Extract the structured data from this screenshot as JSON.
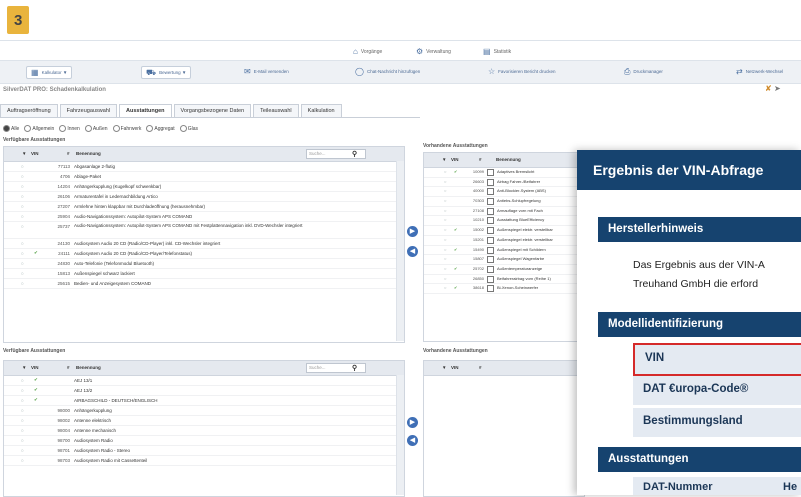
{
  "logo": {
    "text": "3"
  },
  "nav": {
    "items": [
      {
        "label": "Vorgänge",
        "icon": "home-icon"
      },
      {
        "label": "Verwaltung",
        "icon": "gear-icon"
      },
      {
        "label": "Statistik",
        "icon": "chart-icon"
      }
    ]
  },
  "toolbar": {
    "items": [
      {
        "label": "Kalkulator ▼",
        "icon": "calculator-icon"
      },
      {
        "label": "Bewertung ▼",
        "icon": "car-icon"
      },
      {
        "label": "E-Mail versenden",
        "icon": "mail-icon"
      },
      {
        "label": "Chat-Nachricht hinzufügen",
        "icon": "chat-icon"
      },
      {
        "label": "Favorisieren Bericht drucken",
        "icon": "star-icon"
      },
      {
        "label": "Druckmanager",
        "icon": "printer-icon"
      },
      {
        "label": "Netzwerk-Wechsel",
        "icon": "swap-icon"
      }
    ]
  },
  "app": {
    "title": "SilverDAT PRO: Schadenkalkulation"
  },
  "tabs": [
    "Auftragseröffnung",
    "Fahrzeugauswahl",
    "Ausstattungen",
    "Vorgangsbezogene Daten",
    "Teileauswahl",
    "Kalkulation"
  ],
  "filters": [
    "Alle",
    "Allgemein",
    "Innen",
    "Außen",
    "Fahrwerk",
    "Aggregat",
    "Glas"
  ],
  "left_top": {
    "title": "Verfügbare Ausstattungen",
    "headers": {
      "vin": "VIN",
      "hash": "#",
      "name": "Benennung"
    },
    "search_placeholder": "Suche...",
    "rows": [
      {
        "num": "77113",
        "name": "Abgasanlage 2-flutig",
        "vin": ""
      },
      {
        "num": "4706",
        "name": "Ablage-Paket",
        "vin": ""
      },
      {
        "num": "14204",
        "name": "Anhängerkupplung (Kugelkopf schwenkbar)",
        "vin": ""
      },
      {
        "num": "26106",
        "name": "Armaturentafel in Ledernachbildung Artico",
        "vin": ""
      },
      {
        "num": "27207",
        "name": "Armlehne hinten klappbar mit Durchladeöffnung (herausnehmbar)",
        "vin": ""
      },
      {
        "num": "25904",
        "name": "Audio-Navigationssystem: Autopilot-System APS COMAND",
        "vin": ""
      },
      {
        "num": "25737",
        "name": "Audio-Navigationssystem: Autopilot-System APS COMAND mit Festplattennavigation inkl. DVD-Wechsler integriert",
        "vin": ""
      },
      {
        "num": "24130",
        "name": "Audiosystem Audio 20 CD (Radio/CD-Player) inkl. CD-Wechsler integriert",
        "vin": ""
      },
      {
        "num": "24111",
        "name": "Audiosystem Audio 20 CD (Radio/CD-Player/Telefonstatus)",
        "vin": "✔"
      },
      {
        "num": "24830",
        "name": "Auto-Telefonie (Telefonmodul Bluetooth)",
        "vin": ""
      },
      {
        "num": "15813",
        "name": "Außenspiegel schwarz lackiert",
        "vin": ""
      },
      {
        "num": "25615",
        "name": "Bedien- und Anzeigesystem COMAND",
        "vin": ""
      }
    ]
  },
  "left_bottom": {
    "title": "Verfügbare Ausstattungen",
    "headers": {
      "vin": "VIN",
      "hash": "#",
      "name": "Benennung"
    },
    "search_placeholder": "Suche...",
    "rows": [
      {
        "num": "",
        "name": "AEJ 13/1",
        "vin": "✔"
      },
      {
        "num": "",
        "name": "AEJ 13/2",
        "vin": "✔"
      },
      {
        "num": "",
        "name": "AIRBAGSCHILD - DEUTSCH/ENGLISCH",
        "vin": "✔"
      },
      {
        "num": "98000",
        "name": "Anhängerkupplung",
        "vin": ""
      },
      {
        "num": "98002",
        "name": "Antenne elektrisch",
        "vin": ""
      },
      {
        "num": "98004",
        "name": "Antenne mechanisch",
        "vin": ""
      },
      {
        "num": "98700",
        "name": "Audiosystem Radio",
        "vin": ""
      },
      {
        "num": "98701",
        "name": "Audiosystem Radio - Stereo",
        "vin": ""
      },
      {
        "num": "98703",
        "name": "Audiosystem Radio mit Cassettenteil",
        "vin": ""
      }
    ]
  },
  "right_top": {
    "title": "Vorhandene Ausstattungen",
    "headers": {
      "vin": "VIN",
      "hash": "#",
      "name": "Benennung"
    },
    "rows": [
      {
        "num": "10099",
        "name": "Adaptives Bremslicht",
        "vin": "✔"
      },
      {
        "num": "26603",
        "name": "Airbag Fahrer-/Beifahrer",
        "vin": ""
      },
      {
        "num": "40000",
        "name": "Anti-Blockier-System (ABS)",
        "vin": ""
      },
      {
        "num": "70303",
        "name": "Antiebs-Schlupfregelung",
        "vin": ""
      },
      {
        "num": "27108",
        "name": "Armauflage vorn mit Fach",
        "vin": ""
      },
      {
        "num": "10210",
        "name": "Ausstattung BlueEfficiency",
        "vin": ""
      },
      {
        "num": "15002",
        "name": "Außenspiegel elektr. verstellbar",
        "vin": "✔"
      },
      {
        "num": "15201",
        "name": "Außenspiegel elektr. verstellbar",
        "vin": ""
      },
      {
        "num": "15490",
        "name": "Außenspiegel mit Schildern",
        "vin": "✔"
      },
      {
        "num": "15807",
        "name": "Außenspiegel Wagenfarbe",
        "vin": ""
      },
      {
        "num": "25702",
        "name": "Außentemperaturanzeige",
        "vin": "✔"
      },
      {
        "num": "26850",
        "name": "Beifahrerairbag vorn (Reihe 1)",
        "vin": ""
      },
      {
        "num": "38618",
        "name": "Bi-Xenon-Scheinwerfer",
        "vin": "✔"
      }
    ]
  },
  "right_bottom": {
    "title": "Vorhandene Ausstattungen",
    "headers": {
      "vin": "VIN",
      "hash": "#",
      "name": "Benennung"
    }
  },
  "overlay": {
    "title": "Ergebnis der VIN-Abfrage",
    "section_hersteller": "Herstellerhinweis",
    "text_line1": "Das Ergebnis aus der VIN-A",
    "text_line2": "Treuhand GmbH die erford",
    "section_modell": "Modellidentifizierung",
    "field_vin": "VIN",
    "field_dat": "DAT €uropa-Code®",
    "field_land": "Bestimmungsland",
    "section_ausstattungen": "Ausstattungen",
    "col_dat_nummer": "DAT-Nummer",
    "col_he": "He"
  },
  "colors": {
    "navy": "#16436f",
    "vin_border": "#d52a2a",
    "accent": "#e9b43d"
  }
}
